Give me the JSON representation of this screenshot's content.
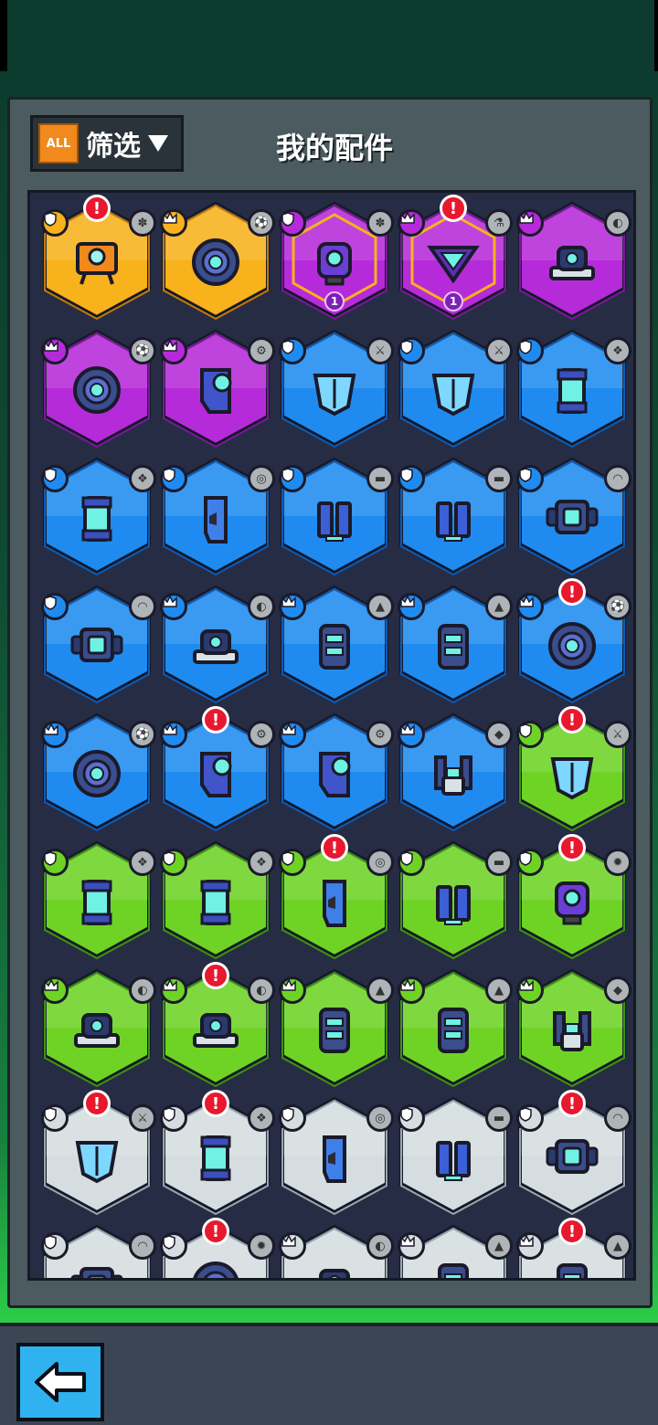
{
  "header": {
    "filter_badge": "ALL",
    "filter_label": "筛选",
    "title": "我的配件"
  },
  "colors": {
    "gold": "#f7b21c",
    "purple": "#b52bd9",
    "blue": "#1f8bf0",
    "green": "#6fd326",
    "white": "#d5dde0"
  },
  "rows": [
    [
      {
        "rarity": "gold",
        "rank": "shield",
        "type": "moss",
        "alert": true,
        "part": "drone-icon",
        "level": ""
      },
      {
        "rarity": "gold",
        "rank": "crown",
        "type": "ball",
        "alert": false,
        "part": "ring-core-icon",
        "level": ""
      },
      {
        "rarity": "purple",
        "rank": "shield",
        "type": "moss",
        "alert": false,
        "part": "robot-icon",
        "level": "1"
      },
      {
        "rarity": "purple",
        "rank": "crown",
        "type": "bottle",
        "alert": true,
        "part": "triangle-core-icon",
        "level": "1"
      },
      {
        "rarity": "purple",
        "rank": "crown",
        "type": "shell",
        "alert": false,
        "part": "turret-icon",
        "level": ""
      }
    ],
    [
      {
        "rarity": "purple",
        "rank": "crown",
        "type": "ball",
        "alert": false,
        "part": "ring-core-icon",
        "level": ""
      },
      {
        "rarity": "purple",
        "rank": "crown",
        "type": "gear",
        "alert": false,
        "part": "cannon-icon",
        "level": ""
      },
      {
        "rarity": "blue",
        "rank": "shield",
        "type": "blade",
        "alert": false,
        "part": "wing-icon",
        "level": ""
      },
      {
        "rarity": "blue",
        "rank": "shield",
        "type": "blade",
        "alert": false,
        "part": "wing-icon",
        "level": ""
      },
      {
        "rarity": "blue",
        "rank": "shield",
        "type": "net",
        "alert": false,
        "part": "cylinder-icon",
        "level": ""
      }
    ],
    [
      {
        "rarity": "blue",
        "rank": "shield",
        "type": "net",
        "alert": false,
        "part": "cylinder-icon",
        "level": ""
      },
      {
        "rarity": "blue",
        "rank": "shield",
        "type": "spiral",
        "alert": false,
        "part": "blade-plate-icon",
        "level": ""
      },
      {
        "rarity": "blue",
        "rank": "shield",
        "type": "brick",
        "alert": false,
        "part": "legs-icon",
        "level": ""
      },
      {
        "rarity": "blue",
        "rank": "shield",
        "type": "brick",
        "alert": false,
        "part": "legs-icon",
        "level": ""
      },
      {
        "rarity": "blue",
        "rank": "shield",
        "type": "dome",
        "alert": false,
        "part": "core-box-icon",
        "level": ""
      }
    ],
    [
      {
        "rarity": "blue",
        "rank": "shield",
        "type": "dome",
        "alert": false,
        "part": "core-box-icon",
        "level": ""
      },
      {
        "rarity": "blue",
        "rank": "crown",
        "type": "shell",
        "alert": false,
        "part": "turret-icon",
        "level": ""
      },
      {
        "rarity": "blue",
        "rank": "crown",
        "type": "cone",
        "alert": false,
        "part": "pod-icon",
        "level": ""
      },
      {
        "rarity": "blue",
        "rank": "crown",
        "type": "cone",
        "alert": false,
        "part": "pod-icon",
        "level": ""
      },
      {
        "rarity": "blue",
        "rank": "crown",
        "type": "ball",
        "alert": true,
        "part": "ring-core-icon",
        "level": ""
      }
    ],
    [
      {
        "rarity": "blue",
        "rank": "crown",
        "type": "ball",
        "alert": false,
        "part": "ring-core-icon",
        "level": ""
      },
      {
        "rarity": "blue",
        "rank": "crown",
        "type": "gear",
        "alert": true,
        "part": "cannon-icon",
        "level": ""
      },
      {
        "rarity": "blue",
        "rank": "crown",
        "type": "gear",
        "alert": false,
        "part": "cannon-icon",
        "level": ""
      },
      {
        "rarity": "blue",
        "rank": "crown",
        "type": "rock",
        "alert": false,
        "part": "claw-icon",
        "level": ""
      },
      {
        "rarity": "green",
        "rank": "shield",
        "type": "blade",
        "alert": true,
        "part": "wing-icon",
        "level": ""
      }
    ],
    [
      {
        "rarity": "green",
        "rank": "shield",
        "type": "net",
        "alert": false,
        "part": "cylinder-icon",
        "level": ""
      },
      {
        "rarity": "green",
        "rank": "shield",
        "type": "net",
        "alert": false,
        "part": "cylinder-icon",
        "level": ""
      },
      {
        "rarity": "green",
        "rank": "shield",
        "type": "spiral",
        "alert": true,
        "part": "blade-plate-icon",
        "level": ""
      },
      {
        "rarity": "green",
        "rank": "shield",
        "type": "brick",
        "alert": false,
        "part": "legs-icon",
        "level": ""
      },
      {
        "rarity": "green",
        "rank": "shield",
        "type": "spiky",
        "alert": true,
        "part": "robot-icon",
        "level": ""
      }
    ],
    [
      {
        "rarity": "green",
        "rank": "crown",
        "type": "shell",
        "alert": false,
        "part": "turret-icon",
        "level": ""
      },
      {
        "rarity": "green",
        "rank": "crown",
        "type": "shell",
        "alert": true,
        "part": "turret-icon",
        "level": ""
      },
      {
        "rarity": "green",
        "rank": "crown",
        "type": "cone",
        "alert": false,
        "part": "pod-icon",
        "level": ""
      },
      {
        "rarity": "green",
        "rank": "crown",
        "type": "cone",
        "alert": false,
        "part": "pod-icon",
        "level": ""
      },
      {
        "rarity": "green",
        "rank": "crown",
        "type": "rock",
        "alert": false,
        "part": "claw-icon",
        "level": ""
      }
    ],
    [
      {
        "rarity": "white",
        "rank": "shield",
        "type": "blade",
        "alert": true,
        "part": "wing-icon",
        "level": ""
      },
      {
        "rarity": "white",
        "rank": "shield",
        "type": "net",
        "alert": true,
        "part": "cylinder-icon",
        "level": ""
      },
      {
        "rarity": "white",
        "rank": "shield",
        "type": "spiral",
        "alert": false,
        "part": "blade-plate-icon",
        "level": ""
      },
      {
        "rarity": "white",
        "rank": "shield",
        "type": "brick",
        "alert": false,
        "part": "legs-icon",
        "level": ""
      },
      {
        "rarity": "white",
        "rank": "shield",
        "type": "dome",
        "alert": true,
        "part": "core-box-icon",
        "level": ""
      }
    ],
    [
      {
        "rarity": "white",
        "rank": "shield",
        "type": "dome",
        "alert": false,
        "part": "core-box-icon",
        "level": ""
      },
      {
        "rarity": "white",
        "rank": "shield",
        "type": "spiky",
        "alert": true,
        "part": "ring-core-icon",
        "level": ""
      },
      {
        "rarity": "white",
        "rank": "crown",
        "type": "shell",
        "alert": false,
        "part": "turret-icon",
        "level": ""
      },
      {
        "rarity": "white",
        "rank": "crown",
        "type": "cone",
        "alert": false,
        "part": "pod-icon",
        "level": ""
      },
      {
        "rarity": "white",
        "rank": "crown",
        "type": "cone",
        "alert": true,
        "part": "pod-icon",
        "level": ""
      }
    ]
  ],
  "footer": {
    "back_icon": "arrow-left-icon"
  }
}
